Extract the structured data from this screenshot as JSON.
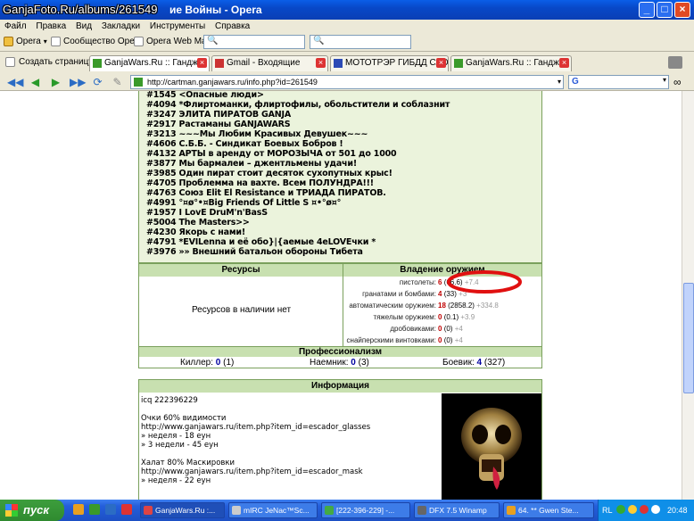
{
  "window": {
    "watermark": "GanjaFoto.Ru/albums/261549",
    "title": "ие Войны - Opera",
    "controls": [
      "_",
      "□",
      "×"
    ]
  },
  "menu": [
    "Файл",
    "Правка",
    "Вид",
    "Закладки",
    "Инструменты",
    "Справка"
  ],
  "toolbar": {
    "opera_label": "Opera",
    "community_label": "Сообщество Opera",
    "webmail_label": "Opera Web Mail"
  },
  "tabs": {
    "new_page": "Создать страницу",
    "items": [
      {
        "label": "GanjaWars.Ru :: Гандж...",
        "icon_color": "#3a9a2a"
      },
      {
        "label": "Gmail - Входящие",
        "icon_color": "#cc3333"
      },
      {
        "label": "МОТОТРЭР ГИБДД САО...",
        "icon_color": "#2b4ab5"
      },
      {
        "label": "GanjaWars.Ru :: Гандж...",
        "icon_color": "#3a9a2a"
      }
    ]
  },
  "address": {
    "url": "http://cartman.ganjawars.ru/info.php?id=261549",
    "search_engine": "G"
  },
  "syndicates": [
    "#1545 <Опасные люди>",
    "#4094 *Флиртоманки, флиртофилы, обольстители и соблазнит",
    "#3247 ЭЛИТА ПИРАТОВ GANJA",
    "#2917 Растаманы GANJAWARS",
    "#3213 ~~~Мы Любим Красивых Девушек~~~",
    "#4606 С.Б.Б. - Синдикат Боевых Бобров !",
    "#4132 АРТЫ в аренду от МОРОЗЫЧА от 501 до 1000",
    "#3877 Мы бармалеи – джентльмены удачи!",
    "#3985 Один пират стоит десяток сухопутных крыс!",
    "#4705 Проблемма на вахте. Всем ПОЛУНДРА!!!",
    "#4763 Союз Elit El Resistance и ТРИАДА ПИРАТОВ.",
    "#4991 °¤ø°•¤Big Friends Of Little S ¤•°ø¤°",
    "#1957 I LovE DruM'n'BasS",
    "#5004 The Masters>>",
    "#4230 Якорь с нами!",
    "#4791 *EVILenna и её обо}|{аемые 4eLOVEчки *",
    "#3976 »» Внешний батальон обороны Тибета"
  ],
  "resources": {
    "header": "Ресурсы",
    "empty_text": "Ресурсов в наличии нет"
  },
  "weapons": {
    "header": "Владение оружием",
    "rows": [
      {
        "label": "пистолеты:",
        "level": "6",
        "exp": "(66.6)",
        "gain": "+7.4"
      },
      {
        "label": "гранатами и бомбами:",
        "level": "4",
        "exp": "(33)",
        "gain": "+3"
      },
      {
        "label": "автоматическим оружием:",
        "level": "18",
        "exp": "(2858.2)",
        "gain": "+334.8"
      },
      {
        "label": "тяжелым оружием:",
        "level": "0",
        "exp": "(0.1)",
        "gain": "+3.9"
      },
      {
        "label": "дробовиками:",
        "level": "0",
        "exp": "(0)",
        "gain": "+4"
      },
      {
        "label": "снайперскими винтовками:",
        "level": "0",
        "exp": "(0)",
        "gain": "+4"
      }
    ]
  },
  "professionalism": {
    "header": "Профессионализм",
    "killer": {
      "label": "Киллер:",
      "level": "0",
      "exp": "(1)"
    },
    "mercenary": {
      "label": "Наемник:",
      "level": "0",
      "exp": "(3)"
    },
    "fighter": {
      "label": "Боевик:",
      "level": "4",
      "exp": "(327)"
    }
  },
  "info": {
    "header": "Информация",
    "lines": [
      "icq 222396229",
      "",
      "Очки 60% видимости",
      "http://www.ganjawars.ru/item.php?item_id=escador_glasses",
      "» неделя - 18 еун",
      "» 3 недели - 45 еун",
      "",
      "Халат 80% Маскировки",
      "http://www.ganjawars.ru/item.php?item_id=escador_mask",
      "» неделя - 22 еун"
    ]
  },
  "taskbar": {
    "start_label": "пуск",
    "items": [
      {
        "label": "GanjaWars.Ru :...",
        "icon_color": "#d44"
      },
      {
        "label": "mIRC JeNac™Sc...",
        "icon_color": "#ccc"
      },
      {
        "label": "[222-396-229] -...",
        "icon_color": "#4a4"
      },
      {
        "label": "DFX 7.5 Winamp",
        "icon_color": "#666"
      },
      {
        "label": "64. ** Gwen Ste...",
        "icon_color": "#e8a020"
      }
    ],
    "lang": "RL",
    "clock": "20:48"
  },
  "colors": {
    "green_header": "#c8e0b0",
    "border_green": "#7aa05c",
    "blue_level": "#0000a0",
    "red_level": "#c00000",
    "gain_gray": "#999999",
    "annotation_red": "#e01010"
  }
}
